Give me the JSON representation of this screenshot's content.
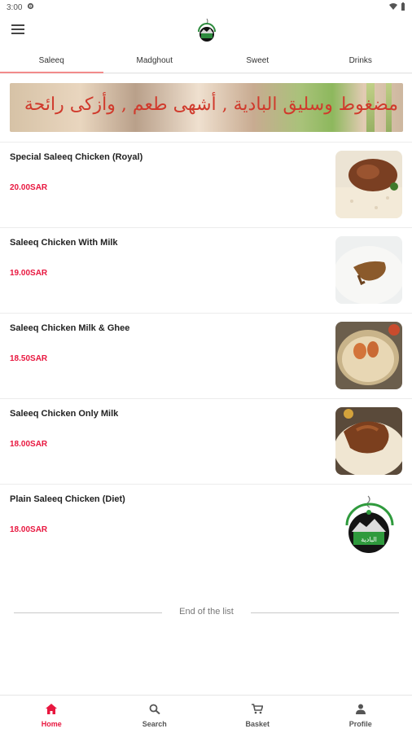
{
  "status_bar": {
    "time": "3:00"
  },
  "tabs": [
    {
      "label": "Saleeq"
    },
    {
      "label": "Madghout"
    },
    {
      "label": "Sweet"
    },
    {
      "label": "Drinks"
    }
  ],
  "banner": {
    "text": "مضغوط وسليق البادية , أشهى طعم , وأزكى رائحة"
  },
  "menu_items": [
    {
      "name": "Special Saleeq Chicken (Royal)",
      "price": "20.00SAR"
    },
    {
      "name": "Saleeq Chicken With Milk",
      "price": "19.00SAR"
    },
    {
      "name": "Saleeq Chicken Milk & Ghee",
      "price": "18.50SAR"
    },
    {
      "name": "Saleeq Chicken Only Milk",
      "price": "18.00SAR"
    },
    {
      "name": "Plain Saleeq Chicken (Diet)",
      "price": "18.00SAR"
    }
  ],
  "logo_text": "البادية",
  "end_of_list": "End of the list",
  "bottom_nav": [
    {
      "label": "Home",
      "icon": "home-icon"
    },
    {
      "label": "Search",
      "icon": "search-icon"
    },
    {
      "label": "Basket",
      "icon": "cart-icon"
    },
    {
      "label": "Profile",
      "icon": "person-icon"
    }
  ],
  "colors": {
    "price": "#e8173f",
    "active_tab": "#f28b8b",
    "banner_text": "#d03a2c"
  }
}
